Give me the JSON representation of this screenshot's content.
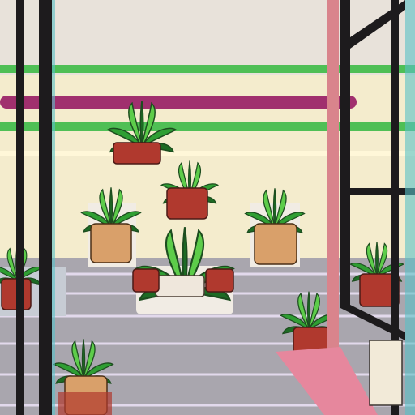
{
  "scene": {
    "kind": "illustration",
    "palette": {
      "ceiling": "#e8e2da",
      "wall": "#f4eccd",
      "floor": "#a9a6ae",
      "floor_line": "#e2d9ec",
      "rail_green": "#4fbf55",
      "rail_magenta": "#a0306e",
      "frame": "#1d1b1d",
      "frame_pink": "#d9848c",
      "leaf_dark": "#1d6b24",
      "leaf": "#2f9e33",
      "leaf_light": "#5dcc4a",
      "pot_terracotta": "#d9a06a",
      "pot_red": "#b0392e",
      "pot_white": "#efe7dc"
    },
    "plants": [
      {
        "id": "top-center",
        "pot": "pot_red"
      },
      {
        "id": "mid-center",
        "pot": "pot_red"
      },
      {
        "id": "left-pedestal",
        "pot": "pot_terracotta"
      },
      {
        "id": "right-pedestal",
        "pot": "pot_terracotta"
      },
      {
        "id": "center-cluster",
        "pot": "pot_red"
      },
      {
        "id": "left-edge",
        "pot": "pot_red"
      },
      {
        "id": "right-edge",
        "pot": "pot_red"
      },
      {
        "id": "right-floor",
        "pot": "pot_red"
      },
      {
        "id": "front-left",
        "pot": "pot_terracotta"
      }
    ]
  }
}
